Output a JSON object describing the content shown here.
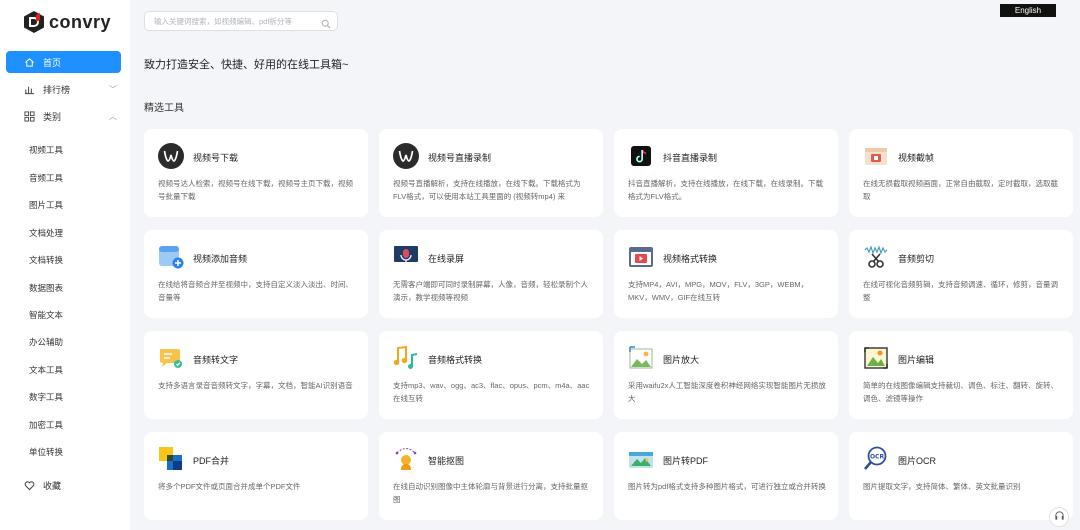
{
  "brand": {
    "name": "convry"
  },
  "search": {
    "placeholder": "输入关键词搜索，如视频编辑、pdf拆分等"
  },
  "lang_button": "English",
  "sidebar": {
    "items": [
      {
        "label": "首页",
        "icon": "home-icon",
        "active": true
      },
      {
        "label": "排行榜",
        "icon": "bar-chart-icon"
      },
      {
        "label": "类别",
        "icon": "grid-icon"
      }
    ],
    "categories": [
      "视频工具",
      "音频工具",
      "图片工具",
      "文档处理",
      "文档转换",
      "数据图表",
      "智能文本",
      "办公辅助",
      "文本工具",
      "数字工具",
      "加密工具",
      "单位转换"
    ],
    "favorites": {
      "label": "收藏",
      "icon": "heart-icon"
    }
  },
  "main": {
    "slogan": "致力打造安全、快捷、好用的在线工具箱~",
    "section_title": "精选工具",
    "cards": [
      {
        "title": "视频号下载",
        "desc": "视频号达人检索，视频号在线下载，视频号主页下载，视频号批量下载",
        "icon": "wechat-channels-icon"
      },
      {
        "title": "视频号直播录制",
        "desc": "视频号直播解析，支持在线播放，在线下载。下载格式为FLV格式，可以使用本站工具里面的 (视频转mp4) 来",
        "icon": "wechat-channels-icon"
      },
      {
        "title": "抖音直播录制",
        "desc": "抖音直播解析，支持在线播放，在线下载，在线录制。下载格式为FLV格式。",
        "icon": "tiktok-icon"
      },
      {
        "title": "视频截帧",
        "desc": "在线无损截取视频画面，正常自由截取，定时截取，选取截取",
        "icon": "video-frame-icon"
      },
      {
        "title": "视频添加音频",
        "desc": "在线给将音频合并至视频中，支持自定义淡入淡出、时间、音量等",
        "icon": "video-add-audio-icon"
      },
      {
        "title": "在线录屏",
        "desc": "无需客户端即可同时录制屏幕，人像，音频，轻松录制个人演示，教学视频等视频",
        "icon": "screen-record-icon"
      },
      {
        "title": "视频格式转换",
        "desc": "支持MP4，AVI，MPG，MOV，FLV，3GP，WEBM，MKV，WMV，GIF在线互转",
        "icon": "video-convert-icon"
      },
      {
        "title": "音频剪切",
        "desc": "在线可视化音频剪辑，支持音频调速、循环，修剪，音量调整",
        "icon": "audio-cut-icon"
      },
      {
        "title": "音频转文字",
        "desc": "支持多语言录音音频转文字，字幕，文档，智能AI识别语音",
        "icon": "speech-to-text-icon"
      },
      {
        "title": "音频格式转换",
        "desc": "支持mp3、wav、ogg、ac3、flac、opus、pcm、m4a、aac在线互转",
        "icon": "music-note-icon"
      },
      {
        "title": "图片放大",
        "desc": "采用waifu2x人工智能深度卷积神经网络实现智能图片无损放大",
        "icon": "image-enlarge-icon"
      },
      {
        "title": "图片编辑",
        "desc": "简单的在线图像编辑支持裁切、调色、标注、翻转、旋转、调色、滤镜等操作",
        "icon": "image-edit-icon"
      },
      {
        "title": "PDF合并",
        "desc": "将多个PDF文件或页面合并成单个PDF文件",
        "icon": "pdf-merge-icon"
      },
      {
        "title": "智能抠图",
        "desc": "在线自动识别图像中主体轮廓与背景进行分离，支持批量抠图",
        "icon": "smart-cutout-icon"
      },
      {
        "title": "图片转PDF",
        "desc": "图片转为pdf格式支持多种图片格式，可进行独立或合并转换",
        "icon": "image-to-pdf-icon"
      },
      {
        "title": "图片OCR",
        "desc": "图片提取文字，支持简体、繁体、英文批量识别",
        "icon": "ocr-icon"
      }
    ]
  },
  "colors": {
    "accent": "#1e90ff",
    "background": "#f4f5f9",
    "card": "#ffffff"
  }
}
